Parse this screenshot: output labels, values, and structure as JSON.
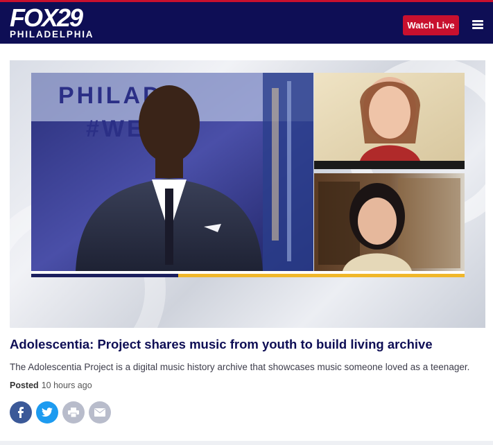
{
  "brand": {
    "logo_main": "FOX29",
    "logo_sub": "PHILADELPHIA",
    "bar_color": "#0e0e55",
    "accent_color": "#c8102e"
  },
  "header": {
    "watch_live_label": "Watch Live",
    "menu_icon": "hamburger-menu-icon"
  },
  "hero": {
    "studio_text_1": "PHILADE",
    "studio_text_2": "#WEEK"
  },
  "article": {
    "headline": "Adolescentia: Project shares music from youth to build living archive",
    "dek": "The Adolescentia Project is a digital music history archive that showcases music someone loved as a teenager.",
    "posted_label": "Posted",
    "posted_time": "10 hours ago"
  },
  "share": {
    "icons": [
      "facebook-icon",
      "twitter-icon",
      "print-icon",
      "email-icon"
    ]
  }
}
